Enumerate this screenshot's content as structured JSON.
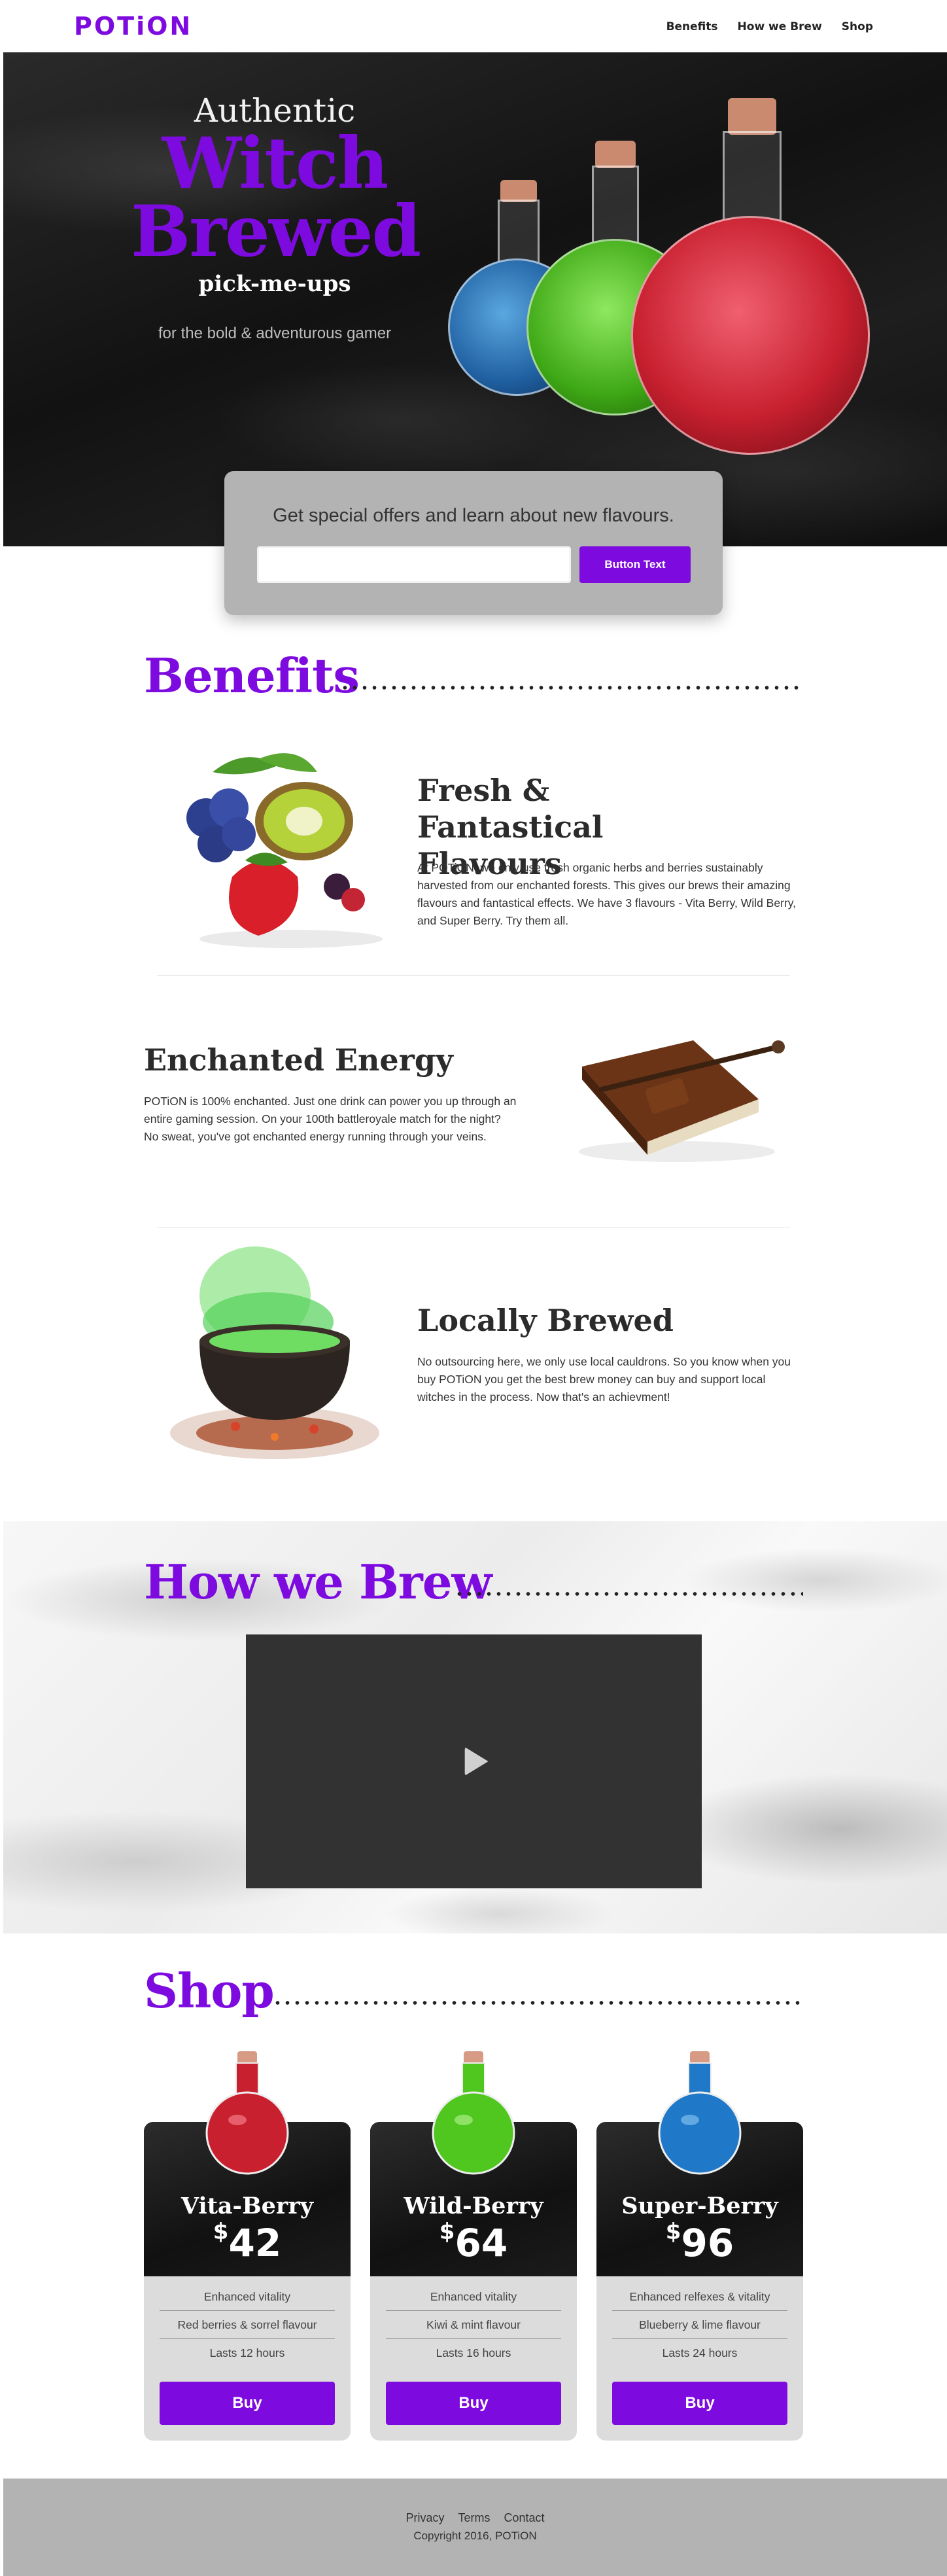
{
  "nav": {
    "logo": "POTiON",
    "links": [
      "Benefits",
      "How we Brew",
      "Shop"
    ]
  },
  "hero": {
    "line1": "Authentic",
    "line2": "Witch",
    "line3": "Brewed",
    "line4": "pick-me-ups",
    "subtitle": "for the bold & adventurous gamer"
  },
  "signup": {
    "title": "Get special offers and learn about new flavours.",
    "input_value": "",
    "button_label": "Button Text"
  },
  "benefits": {
    "heading": "Benefits",
    "items": [
      {
        "title": "Fresh & Fantastical Flavours",
        "text": "At POTiON, we only use fresh organic herbs and berries sustainably harvested from our enchanted forests. This gives our brews their amazing flavours and fantastical effects. We have 3 flavours - Vita Berry, Wild Berry, and Super Berry. Try them all."
      },
      {
        "title": "Enchanted Energy",
        "text": "POTiON is 100% enchanted. Just one drink can power you up through an entire gaming session. On your 100th battleroyale match for the night? No sweat, you've got enchanted energy running through your veins."
      },
      {
        "title": "Locally Brewed",
        "text": "No outsourcing here, we only use local cauldrons. So you know when you buy POTiON you get the best brew money can buy and support local witches in the process. Now that's an achievment!"
      }
    ]
  },
  "brew": {
    "heading": "How we Brew"
  },
  "shop": {
    "heading": "Shop",
    "products": [
      {
        "name": "Vita-Berry",
        "currency": "$",
        "price": "42",
        "features": [
          "Enhanced vitality",
          "Red berries & sorrel flavour",
          "Lasts 12 hours"
        ],
        "button": "Buy",
        "color": "#c8202f"
      },
      {
        "name": "Wild-Berry",
        "currency": "$",
        "price": "64",
        "features": [
          "Enhanced vitality",
          "Kiwi & mint flavour",
          "Lasts 16 hours"
        ],
        "button": "Buy",
        "color": "#4fc71f"
      },
      {
        "name": "Super-Berry",
        "currency": "$",
        "price": "96",
        "features": [
          "Enhanced relfexes & vitality",
          "Blueberry & lime  flavour",
          "Lasts 24 hours"
        ],
        "button": "Buy",
        "color": "#1f78c8"
      }
    ]
  },
  "footer": {
    "links": [
      "Privacy",
      "Terms",
      "Contact"
    ],
    "copyright": "Copyright 2016, POTiON"
  },
  "colors": {
    "brand": "#7d0be0",
    "dark": "#2b2b2b",
    "grey_panel": "#b3b3b3"
  }
}
